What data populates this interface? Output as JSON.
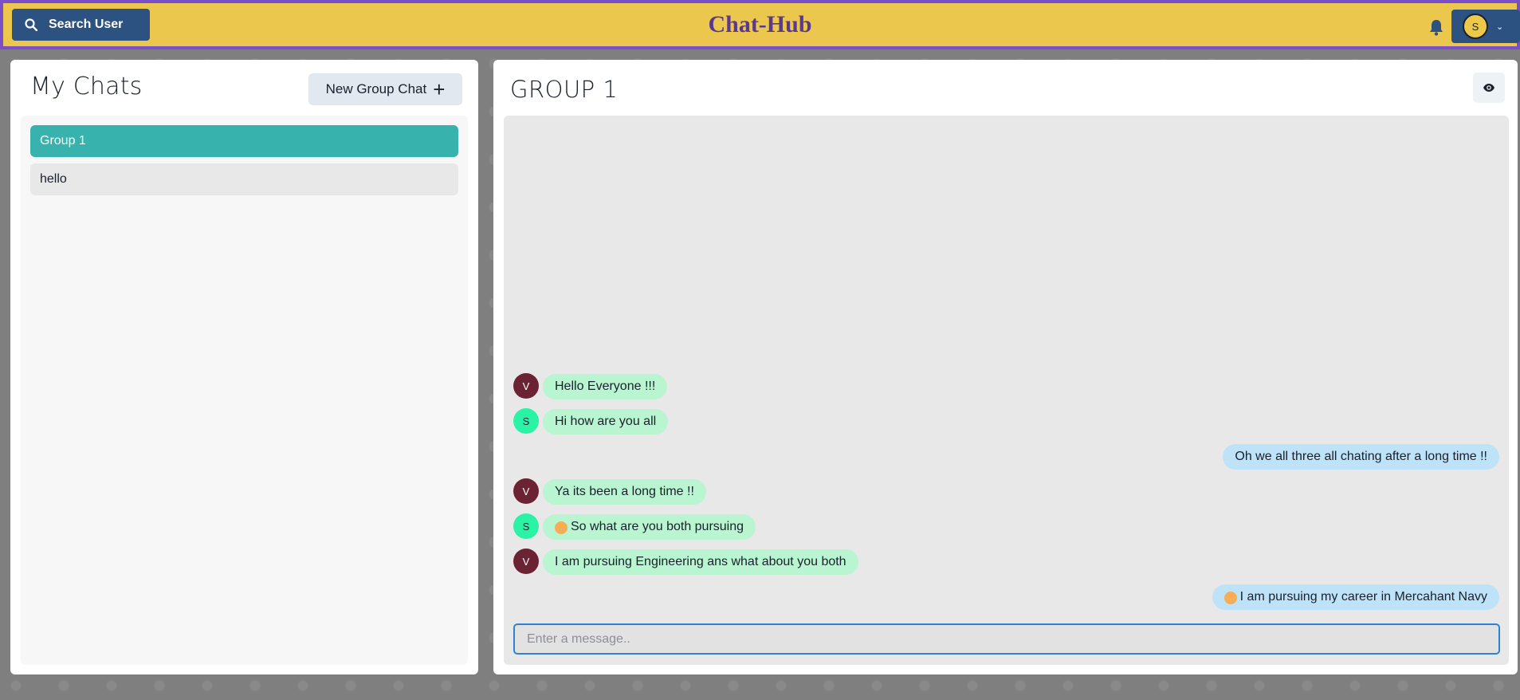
{
  "header": {
    "search_label": "Search User",
    "brand": "Chat-Hub",
    "profile_initial": "S"
  },
  "sidebar": {
    "title": "My Chats",
    "new_group_label": "New Group Chat",
    "chats": [
      {
        "name": "Group 1",
        "active": true
      },
      {
        "name": "hello",
        "active": false
      }
    ]
  },
  "conversation": {
    "title": "GROUP 1",
    "messages": [
      {
        "sender": "V",
        "text": "Hello Everyone !!!",
        "mine": false
      },
      {
        "sender": "S",
        "text": "Hi how are you all",
        "mine": false
      },
      {
        "sender": "",
        "text": "Oh we all three all chating after a long time !!",
        "mine": true
      },
      {
        "sender": "V",
        "text": "Ya its been a long time !!",
        "mine": false
      },
      {
        "sender": "S",
        "text": "So what are you both pursuing",
        "mine": false,
        "emoji": true
      },
      {
        "sender": "V",
        "text": "I am pursuing Engineering ans what about you both",
        "mine": false
      },
      {
        "sender": "",
        "text": "I am pursuing my career in Mercahant Navy",
        "mine": true,
        "emoji": true
      }
    ],
    "input_placeholder": "Enter a message.."
  },
  "colors": {
    "header_bg": "#ebc84d",
    "header_border": "#7b4fc9",
    "accent_teal": "#38b2ac",
    "bubble_other": "#b9f5d0",
    "bubble_mine": "#bee3f8"
  }
}
